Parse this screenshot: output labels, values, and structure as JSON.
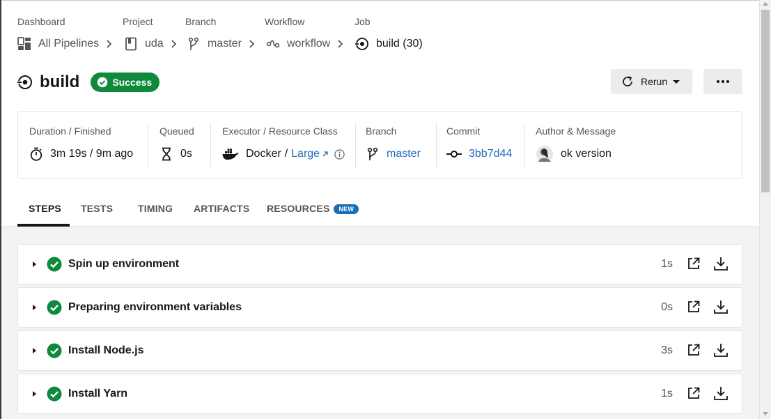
{
  "breadcrumb": {
    "dashboard": {
      "label": "Dashboard",
      "value": "All Pipelines"
    },
    "project": {
      "label": "Project",
      "value": "uda"
    },
    "branch": {
      "label": "Branch",
      "value": "master"
    },
    "workflow": {
      "label": "Workflow",
      "value": "workflow"
    },
    "job": {
      "label": "Job",
      "value": "build (30)"
    }
  },
  "header": {
    "title": "build",
    "status": "Success",
    "rerun_label": "Rerun",
    "status_color": "#0f8a3c"
  },
  "meta": {
    "duration": {
      "label": "Duration / Finished",
      "value": "3m 19s / 9m ago"
    },
    "queued": {
      "label": "Queued",
      "value": "0s"
    },
    "executor": {
      "label": "Executor / Resource Class",
      "executor": "Docker",
      "separator": "/",
      "resource_class": "Large"
    },
    "branch": {
      "label": "Branch",
      "value": "master"
    },
    "commit": {
      "label": "Commit",
      "value": "3bb7d44"
    },
    "author": {
      "label": "Author & Message",
      "message": "ok version"
    }
  },
  "tabs": {
    "steps": "STEPS",
    "tests": "TESTS",
    "timing": "TIMING",
    "artifacts": "ARTIFACTS",
    "resources": "RESOURCES",
    "new_badge": "NEW"
  },
  "steps": [
    {
      "name": "Spin up environment",
      "duration": "1s"
    },
    {
      "name": "Preparing environment variables",
      "duration": "0s"
    },
    {
      "name": "Install Node.js",
      "duration": "3s"
    },
    {
      "name": "Install Yarn",
      "duration": "1s"
    }
  ],
  "colors": {
    "accent": "#1c6db7",
    "success": "#0f8a3c"
  }
}
